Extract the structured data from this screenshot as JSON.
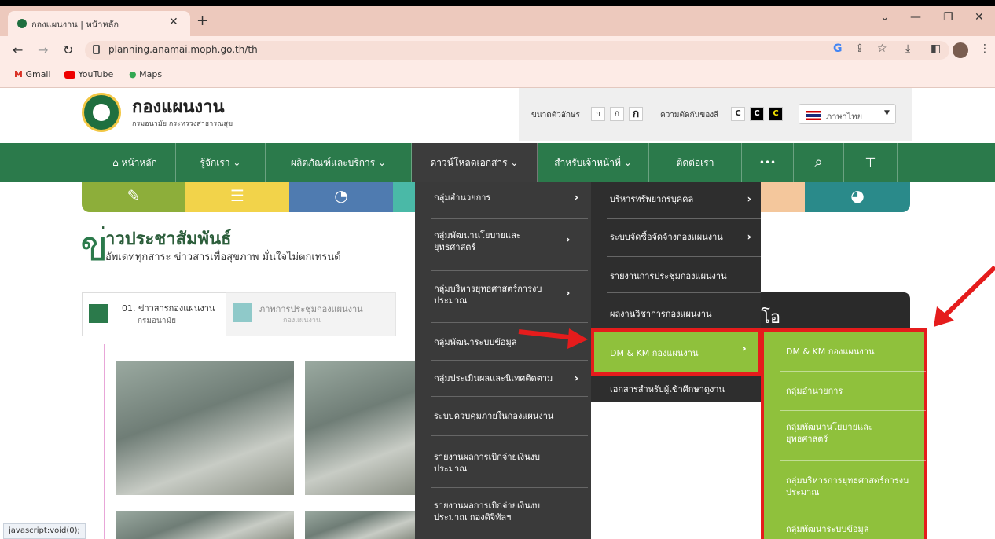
{
  "browser": {
    "tab_title": "กองแผนงาน | หน้าหลัก",
    "new_tab": "+",
    "url": "planning.anamai.moph.go.th/th",
    "bookmarks": [
      "Gmail",
      "YouTube",
      "Maps"
    ],
    "status_text": "javascript:void(0);"
  },
  "header": {
    "brand": "กองแผนงาน",
    "brand_sub": "กรมอนามัย กระทรวงสาธารณสุข",
    "font_size_label": "ขนาดตัวอักษร",
    "font_sizes": [
      "ก",
      "ก",
      "ก"
    ],
    "contrast_label": "ความตัดกันของสี",
    "contrast": [
      "C",
      "C",
      "C"
    ],
    "language": "ภาษาไทย"
  },
  "nav": {
    "home": "หน้าหลัก",
    "about": "รู้จักเรา",
    "products": "ผลิตภัณฑ์และบริการ",
    "download": "ดาวน์โหลดเอกสาร",
    "staff": "สำหรับเจ้าหน้าที่",
    "contact": "ติดต่อเรา",
    "more": "•••"
  },
  "news": {
    "big": "ข",
    "title": "่าวประชาสัมพันธ์",
    "subtitle": "อัพเดททุกสาระ ข่าวสารเพื่อสุขภาพ มั่นใจไม่ตกเทรนด์",
    "tab1_line1": "01. ข่าวสารกองแผนงาน",
    "tab1_line2": "กรมอนามัย",
    "tab2_line1": "ภาพการประชุมกองแผนงาน",
    "tab2_line2": "กองแผนงาน",
    "dark_box_text": "โอ"
  },
  "menu_level1": [
    "กลุ่มอำนวยการ",
    "กลุ่มพัฒนานโยบายและยุทธศาสตร์",
    "กลุ่มบริหารยุทธศาสตร์การงบประมาณ",
    "กลุ่มพัฒนาระบบข้อมูล",
    "กลุ่มประเมินผลและนิเทศติดตาม",
    "ระบบควบคุมภายในกองแผนงาน",
    "รายงานผลการเบิกจ่ายเงินงบประมาณ",
    "รายงานผลการเบิกจ่ายเงินงบประมาณ กองดิจิทัลฯ"
  ],
  "menu_level2": [
    "บริหารทรัพยากรบุคคล",
    "ระบบจัดซื้อจัดจ้างกองแผนงาน",
    "รายงานการประชุมกองแผนงาน",
    "ผลงานวิชาการกองแผนงาน",
    "DM & KM กองแผนงาน",
    "เอกสารสำหรับผู้เข้าศึกษาดูงาน"
  ],
  "menu_level3": [
    "DM & KM กองแผนงาน",
    "กลุ่มอำนวยการ",
    "กลุ่มพัฒนานโยบายและยุทธศาสตร์",
    "กลุ่มบริหารการยุทธศาสตร์การงบประมาณ",
    "กลุ่มพัฒนาระบบข้อมูล"
  ],
  "colors": {
    "nav_green": "#2b7a4b",
    "menu_dark": "#3a3a3a",
    "highlight_green": "#8fc13c",
    "annotation_red": "#e51c1c"
  },
  "icons": [
    "search-icon",
    "sitemap-icon",
    "home-icon",
    "chevron-right-icon"
  ]
}
